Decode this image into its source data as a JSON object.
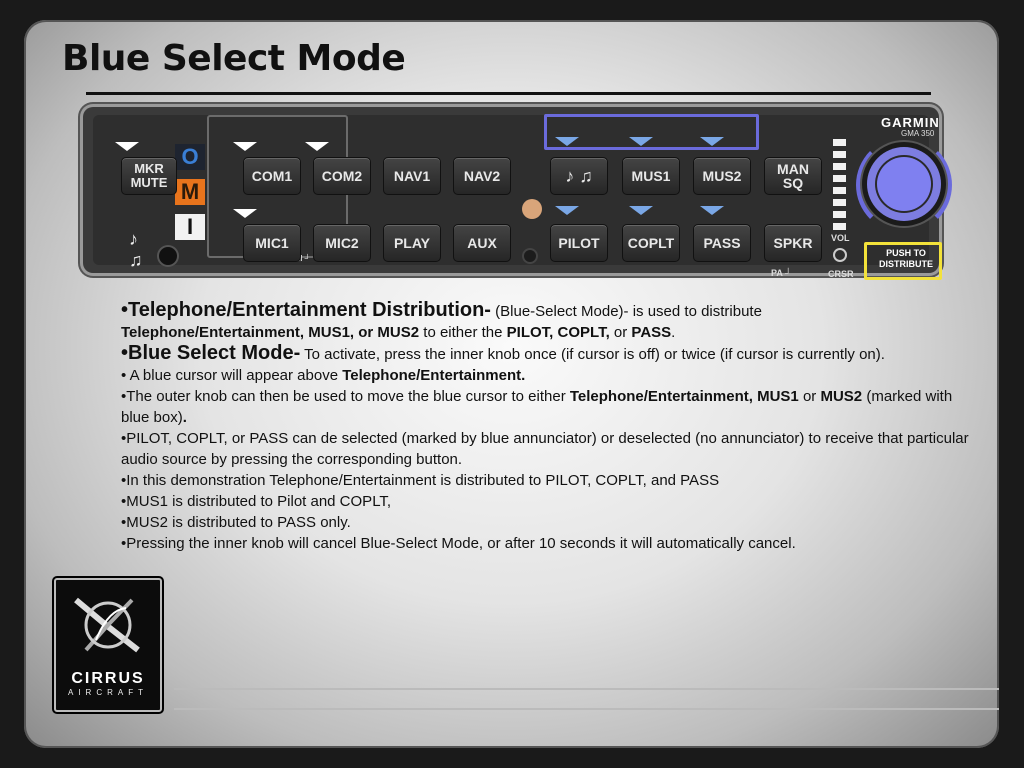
{
  "slide": {
    "title": "Blue Select Mode"
  },
  "panel": {
    "brand": "GARMIN",
    "model": "GMA 350",
    "buttons": {
      "mkr_mute": "MKR\nMUTE",
      "com1": "COM1",
      "com2": "COM2",
      "nav1": "NAV1",
      "nav2": "NAV2",
      "tel_ent": "♪ ♫",
      "mus1": "MUS1",
      "mus2": "MUS2",
      "man_sq": "MAN\nSQ",
      "mic1": "MIC1",
      "mic2": "MIC2",
      "play": "PLAY",
      "aux": "AUX",
      "pilot": "PILOT",
      "coplt": "COPLT",
      "pass": "PASS",
      "spkr": "SPKR"
    },
    "marker_letters": {
      "o": "O",
      "m": "M",
      "i": "I"
    },
    "labels": {
      "split_com": "└ SPLIT COM ┘",
      "pa": "PA ┘",
      "vol": "VOL",
      "crsr": "CRSR",
      "push_to_distribute": "PUSH TO\nDISTRIBUTE"
    },
    "colors": {
      "blue_select": "#6b6bdc",
      "highlight_yellow": "#f3e23a",
      "marker_o": "#3a7fd6",
      "marker_m": "#e8741c",
      "marker_i": "#f2f2f2"
    }
  },
  "body": {
    "p1_lead": "•Telephone/Entertainment Distribution-",
    "p1_a": "  (Blue-Select Mode)- is used to distribute ",
    "p1_b": "Telephone/Entertainment, MUS1, or MUS2",
    "p1_c": " to either the ",
    "p1_d": "PILOT, COPLT,",
    "p1_e": " or ",
    "p1_f": "PASS",
    "p1_g": ".",
    "p2_lead": "•Blue Select Mode-",
    "p2_a": "  To activate, press the inner knob once (if cursor is off) or twice (if cursor is currently on).",
    "p3_a": "• A blue cursor will appear above ",
    "p3_b": "Telephone/Entertainment.",
    "p4_a": "•The outer knob can then be used to move the blue cursor to either ",
    "p4_b": "Telephone/Entertainment,  MUS1",
    "p4_c": " or ",
    "p4_d": "MUS2",
    "p4_e": " (marked with blue box)",
    "p4_f": ".",
    "p5": "•PILOT, COPLT, or PASS can de selected (marked by blue annunciator) or deselected (no annunciator) to receive that particular audio source by pressing the corresponding button.",
    "p6": "•In this demonstration Telephone/Entertainment is distributed to PILOT, COPLT, and PASS",
    "p7": "•MUS1 is distributed to Pilot and COPLT,",
    "p8": "•MUS2 is distributed to PASS only.",
    "p9": "•Pressing the inner knob will cancel Blue-Select Mode, or after 10 seconds it will automatically cancel."
  },
  "logo": {
    "word": "CIRRUS",
    "sub": "AIRCRAFT"
  }
}
